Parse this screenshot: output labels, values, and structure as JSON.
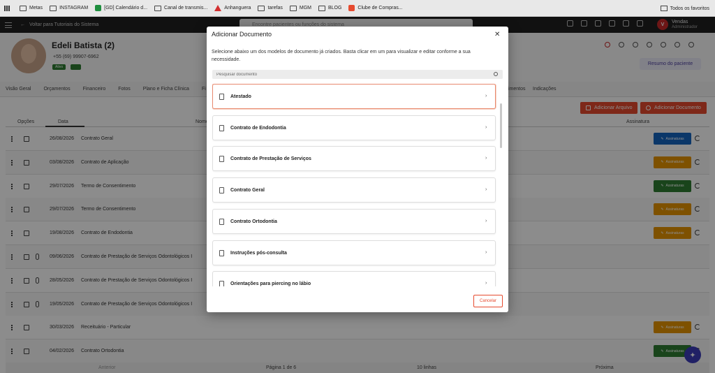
{
  "bookmarks": {
    "items": [
      "Metas",
      "INSTAGRAM",
      "[GD] Calendário d...",
      "Canal de transmis...",
      "Anhanguera",
      "tarefas",
      "MGM",
      "BLOG",
      "Clube de Compras..."
    ],
    "right": "Todos os favoritos"
  },
  "header": {
    "back_label": "Voltar para Tutoriais do Sistema",
    "search_placeholder": "Encontre pacientes ou funções do sistema",
    "user_initial": "V",
    "user_name": "Vendas",
    "user_role": "Administrador"
  },
  "patient": {
    "name": "Edeli Batista (2)",
    "phone": "+55 (69) 99907-6962",
    "status": "Ativo",
    "summary_button": "Resumo do paciente"
  },
  "tabs": [
    "Visão Geral",
    "Orçamentos",
    "Financeiro",
    "Fotos",
    "Plano e Ficha Clínica",
    "Fi",
    "imentos",
    "Indicações"
  ],
  "actions": {
    "add_file": "Adicionar Arquivo",
    "add_document": "Adicionar Documento"
  },
  "table": {
    "headers": {
      "options": "Opções",
      "date": "Data",
      "name": "Nome",
      "signature": "Assinatura"
    },
    "rows": [
      {
        "date": "26/08/2026",
        "name": "Contrato Geral",
        "sig": "Assinaturas",
        "sig_color": "#1565c0",
        "clip": false
      },
      {
        "date": "03/08/2026",
        "name": "Contrato de Aplicação",
        "sig": "Assinaturas",
        "sig_color": "#e69400",
        "clip": false
      },
      {
        "date": "29/07/2026",
        "name": "Termo de Consentimento",
        "sig": "Assinaturas",
        "sig_color": "#2e7d32",
        "clip": false
      },
      {
        "date": "29/07/2026",
        "name": "Termo de Consentimento",
        "sig": "Assinaturas",
        "sig_color": "#e69400",
        "clip": false
      },
      {
        "date": "19/08/2026",
        "name": "Contrato de Endodontia",
        "sig": "Assinaturas",
        "sig_color": "#e69400",
        "clip": false
      },
      {
        "date": "09/06/2026",
        "name": "Contrato de Prestação de Serviços Odontológicos I",
        "sig": "",
        "sig_color": "",
        "clip": true
      },
      {
        "date": "28/05/2026",
        "name": "Contrato de Prestação de Serviços Odontológicos I",
        "sig": "",
        "sig_color": "",
        "clip": true
      },
      {
        "date": "19/05/2026",
        "name": "Contrato de Prestação de Serviços Odontológicos I",
        "sig": "",
        "sig_color": "",
        "clip": true
      },
      {
        "date": "30/03/2026",
        "name": "Receituário - Particular",
        "sig": "Assinaturas",
        "sig_color": "#e69400",
        "clip": false
      },
      {
        "date": "04/02/2026",
        "name": "Contrato Ortodontia",
        "sig": "Assinaturas",
        "sig_color": "#2e7d32",
        "clip": false
      }
    ]
  },
  "pager": {
    "prev": "Anterior",
    "page": "Página 1 de 6",
    "per_page": "10 linhas",
    "next": "Próxima"
  },
  "modal": {
    "title": "Adicionar Documento",
    "description": "Selecione abaixo um dos modelos de documento já criados. Basta clicar em um para visualizar e editar conforme a sua necessidade.",
    "search_placeholder": "Pesquisar documento",
    "items": [
      "Atestado",
      "Contrato de Endodontia",
      "Contrato de Prestação de Serviços",
      "Contrato Geral",
      "Contrato Ortodontia",
      "Instruções pós-consulta",
      "Orientações para piercing no lábio"
    ],
    "cancel": "Cancelar"
  },
  "colors": {
    "accent": "#e64a2e",
    "header_bg": "#1f1f1f",
    "fab": "#3b3bb8"
  }
}
